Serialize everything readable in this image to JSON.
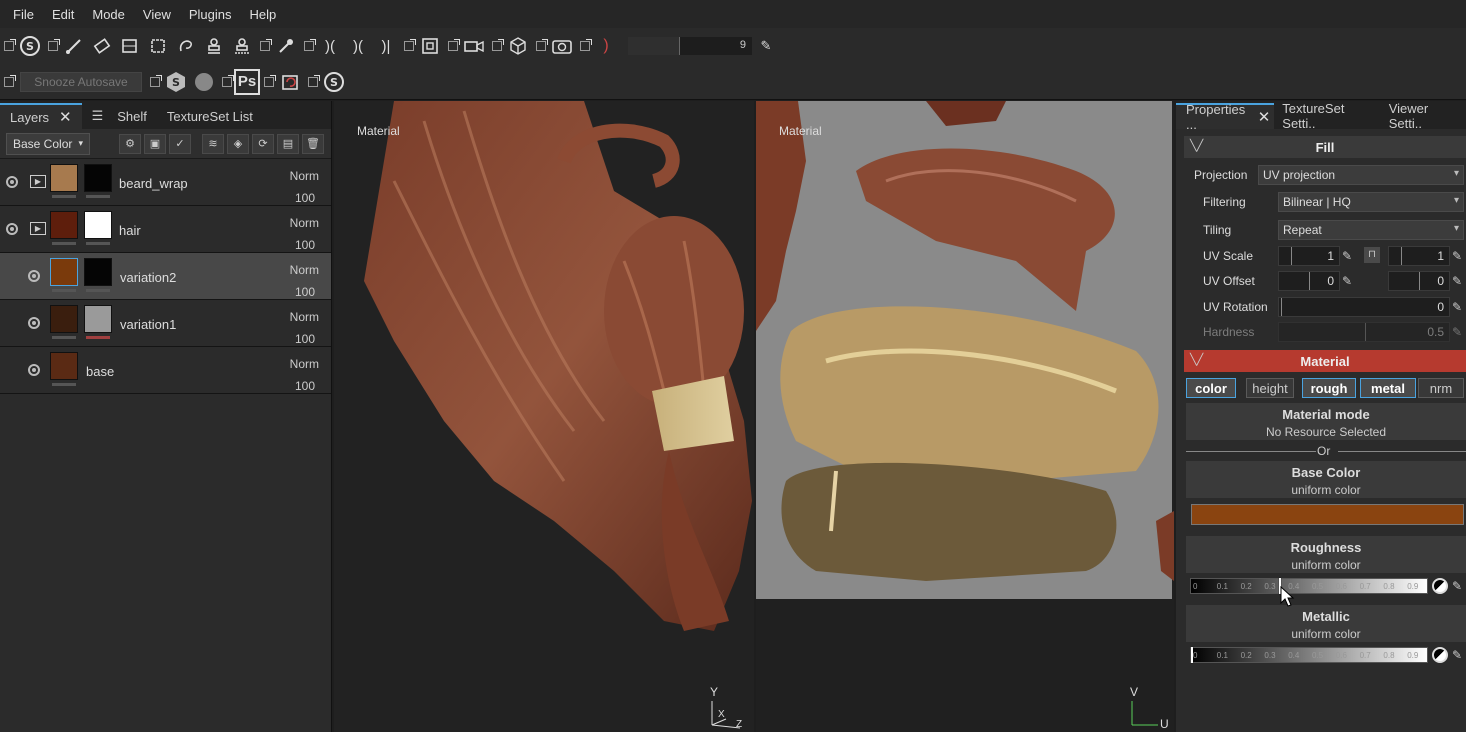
{
  "menu": [
    "File",
    "Edit",
    "Mode",
    "View",
    "Plugins",
    "Help"
  ],
  "toolbar": {
    "brush_size_value": "9",
    "snooze_label": "Snooze Autosave",
    "ps_label": "Ps"
  },
  "layers_panel": {
    "tabs": [
      "Layers",
      "Shelf",
      "TextureSet List"
    ],
    "channel_dropdown": "Base Color",
    "layers": [
      {
        "name": "beard_wrap",
        "blend": "Norm",
        "opacity": "100",
        "thumb": "#a77a4e",
        "mask": "#050505",
        "folder": true,
        "indent": false,
        "selected": false
      },
      {
        "name": "hair",
        "blend": "Norm",
        "opacity": "100",
        "thumb": "#5e1e0c",
        "mask": "#ffffff",
        "folder": true,
        "indent": false,
        "selected": false
      },
      {
        "name": "variation2",
        "blend": "Norm",
        "opacity": "100",
        "thumb": "#7a3a0c",
        "mask": "#050505",
        "folder": false,
        "indent": true,
        "selected": true
      },
      {
        "name": "variation1",
        "blend": "Norm",
        "opacity": "100",
        "thumb": "#3a1e0e",
        "mask": "#9a9a9a",
        "folder": false,
        "indent": true,
        "selected": false
      },
      {
        "name": "base",
        "blend": "Norm",
        "opacity": "100",
        "thumb": "#5a2a14",
        "mask": "",
        "folder": false,
        "indent": true,
        "selected": false
      }
    ]
  },
  "viewport_3d": {
    "label": "Material",
    "axis_y": "Y",
    "axis_x": "X",
    "axis_z": "Z"
  },
  "viewport_2d": {
    "label": "Material",
    "axis_v": "V",
    "axis_u": "U"
  },
  "properties": {
    "tabs": [
      "Properties ...",
      "TextureSet Setti..",
      "Viewer Setti.."
    ],
    "fill_title": "Fill",
    "projection_label": "Projection",
    "projection_value": "UV projection",
    "filtering_label": "Filtering",
    "filtering_value": "Bilinear | HQ",
    "tiling_label": "Tiling",
    "tiling_value": "Repeat",
    "uv_scale_label": "UV Scale",
    "uv_scale_a": "1",
    "uv_scale_b": "1",
    "uv_offset_label": "UV Offset",
    "uv_offset_a": "0",
    "uv_offset_b": "0",
    "uv_rotation_label": "UV Rotation",
    "uv_rotation_value": "0",
    "hardness_label": "Hardness",
    "hardness_value": "0.5",
    "material_title": "Material",
    "channels": [
      {
        "label": "color",
        "on": true
      },
      {
        "label": "height",
        "on": false
      },
      {
        "label": "rough",
        "on": true
      },
      {
        "label": "metal",
        "on": true
      },
      {
        "label": "nrm",
        "on": false
      }
    ],
    "material_mode_title": "Material mode",
    "material_mode_value": "No Resource Selected",
    "or_label": "Or",
    "base_color_title": "Base Color",
    "base_color_sub": "uniform color",
    "base_color_swatch": "#8a4410",
    "roughness_title": "Roughness",
    "roughness_sub": "uniform color",
    "roughness_value": 0.37,
    "metallic_title": "Metallic",
    "metallic_sub": "uniform color",
    "metallic_value": 0,
    "gradient_ticks": [
      "0",
      "0.1",
      "0.2",
      "0.3",
      "0.4",
      "0.5",
      "0.6",
      "0.7",
      "0.8",
      "0.9"
    ]
  },
  "colors": {
    "accent": "#4aa3df",
    "material_header": "#b63a2f",
    "fill_header": "#3a3a3a"
  }
}
